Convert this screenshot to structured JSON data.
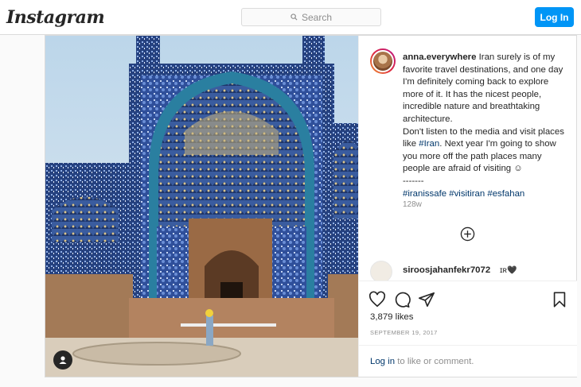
{
  "app": {
    "brand": "Instagram"
  },
  "header": {
    "search_placeholder": "Search",
    "login_label": "Log In"
  },
  "post": {
    "username": "anna.everywhere",
    "caption_parts": {
      "p1": "Iran surely is of my favorite travel destinations, and one day I'm definitely coming back to explore more of it. It has the nicest people, incredible nature and breathtaking architecture.",
      "p2a": "Don't listen to the media and visit places like ",
      "p2tag": "#Iran",
      "p2b": ". Next year I'm going to show you more off the path places many people are afraid of visiting ☺",
      "sep": "-------",
      "tag1": "#iranissafe",
      "tag2": "#visitiran",
      "tag3": "#esfahan"
    },
    "time_ago": "128w",
    "comment": {
      "username": "siroosjahanfekr7072",
      "text": "ɪʀ🖤"
    },
    "likes": "3,879 likes",
    "date": "SEPTEMBER 19, 2017",
    "login_prompt": {
      "link": "Log in",
      "rest": " to like or comment."
    }
  },
  "icons": {
    "search": "search-icon",
    "like": "heart-icon",
    "comment": "comment-icon",
    "share": "share-icon",
    "save": "bookmark-icon",
    "more": "plus-circle-icon",
    "tagged": "user-tag-icon"
  },
  "colors": {
    "accent": "#0095f6",
    "link": "#00376b",
    "muted": "#8e8e8e"
  }
}
